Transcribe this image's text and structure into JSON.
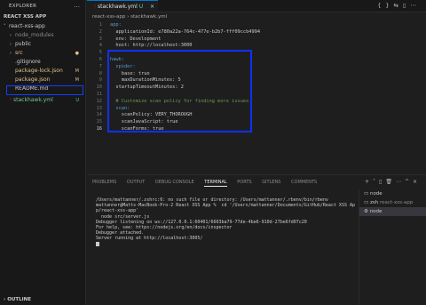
{
  "sidebar": {
    "title": "EXPLORER",
    "more": "...",
    "section": "REACT XSS APP",
    "items": [
      {
        "label": "react-xss-app",
        "chev": "˅",
        "badge": ""
      },
      {
        "label": "node_modules",
        "chev": "›",
        "badge": ""
      },
      {
        "label": "public",
        "chev": "›",
        "badge": ""
      },
      {
        "label": "src",
        "chev": "›",
        "badge": "●"
      },
      {
        "label": ".gitignore",
        "chev": "",
        "badge": ""
      },
      {
        "label": "package-lock.json",
        "chev": "",
        "badge": "M"
      },
      {
        "label": "package.json",
        "chev": "",
        "badge": "M"
      },
      {
        "label": "README.md",
        "chev": "",
        "badge": ""
      },
      {
        "label": "stackhawk.yml",
        "chev": "",
        "badge": "U"
      }
    ],
    "outline": "OUTLINE"
  },
  "tabs": [
    {
      "label": "stackhawk.yml",
      "status": "U",
      "close": "×"
    }
  ],
  "breadcrumb": "react-xss-app  ›  stackhawk.yml",
  "editor": {
    "lines": [
      {
        "n": "1",
        "text": "app:"
      },
      {
        "n": "2",
        "text": "  applicationId: e780a22a-764c-477e-b2b7-fff09ccb4994"
      },
      {
        "n": "3",
        "text": "  env: Development"
      },
      {
        "n": "4",
        "text": "  host: http://localhost:3000"
      },
      {
        "n": "5",
        "text": ""
      },
      {
        "n": "6",
        "text": "hawk:"
      },
      {
        "n": "7",
        "text": "  spider:"
      },
      {
        "n": "8",
        "text": "    base: true"
      },
      {
        "n": "9",
        "text": "    maxDurationMinutes: 5"
      },
      {
        "n": "10",
        "text": "  startupTimeoutMinutes: 2"
      },
      {
        "n": "11",
        "text": ""
      },
      {
        "n": "12",
        "text": "  # Customize scan policy for finding more issues"
      },
      {
        "n": "13",
        "text": "  scan:"
      },
      {
        "n": "14",
        "text": "    scanPolicy: VERY_THOROUGH"
      },
      {
        "n": "15",
        "text": "    scanJavaScript: true"
      },
      {
        "n": "16",
        "text": "    scanForms: true"
      }
    ]
  },
  "panel": {
    "tabs": [
      "PROBLEMS",
      "OUTPUT",
      "DEBUG CONSOLE",
      "TERMINAL",
      "PORTS",
      "GITLENS",
      "COMMENTS"
    ],
    "active_tab": "TERMINAL",
    "terminal_lines": [
      "/Users/mattanner/.zshrc:6: no such file or directory: /Users/mattanner/.rbenv/bin/rbenv",
      "mattanner@Matts-MacBook-Pro-2 React XSS App %  cd '/Users/mattanner/Documents/GitHub/React XSS Ap",
      "p/react-xss-app'",
      "  node src/server.js",
      "Debugger listening on ws://127.0.0.1:60401/6603ba79-77de-4be6-910d-27be6fd07c20",
      "For help, see: https://nodejs.org/en/docs/inspector",
      "Debugger attached.",
      "Server running at http://localhost:3005/"
    ],
    "sessions": [
      {
        "name": "node",
        "desc": ""
      },
      {
        "name": "zsh",
        "desc": " react-xss-app"
      },
      {
        "name": "node",
        "desc": ""
      }
    ]
  }
}
